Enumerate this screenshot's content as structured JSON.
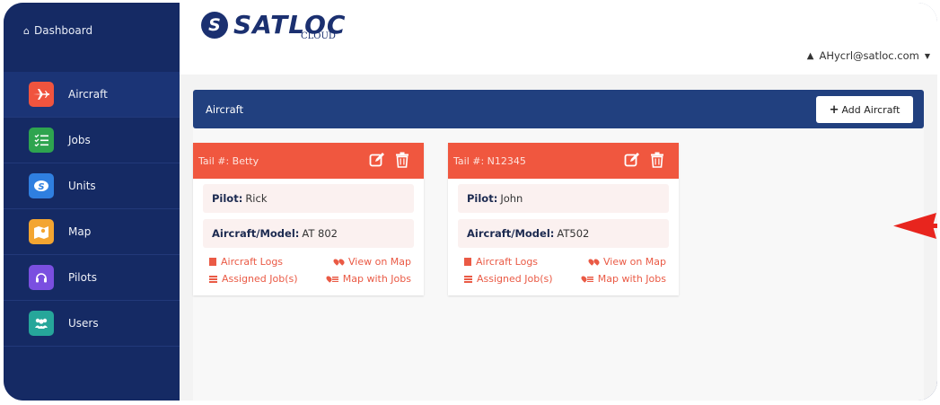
{
  "sidebar": {
    "dashboard_label": "Dashboard",
    "items": [
      {
        "label": "Aircraft",
        "icon": "airplane-icon",
        "color": "#f0543e",
        "active": true
      },
      {
        "label": "Jobs",
        "icon": "checklist-icon",
        "color": "#2ea44f"
      },
      {
        "label": "Units",
        "icon": "satloc-unit-icon",
        "color": "#2f7fe0"
      },
      {
        "label": "Map",
        "icon": "map-icon",
        "color": "#f3a531"
      },
      {
        "label": "Pilots",
        "icon": "headset-icon",
        "color": "#7a4fe0"
      },
      {
        "label": "Users",
        "icon": "users-icon",
        "color": "#26a69a"
      }
    ]
  },
  "header": {
    "logo_text": "SATLOC",
    "logo_subtext": "CLOUD",
    "user_email": "AHycrl@satloc.com"
  },
  "panel": {
    "title": "Aircraft",
    "add_button_label": "Add Aircraft"
  },
  "cards": [
    {
      "title": "Tail #: Betty",
      "pilot_label": "Pilot:",
      "pilot_value": "Rick",
      "model_label": "Aircraft/Model:",
      "model_value": "AT 802",
      "link_logs": "Aircraft Logs",
      "link_view_map": "View on Map",
      "link_jobs": "Assigned Job(s)",
      "link_map_jobs": "Map with Jobs"
    },
    {
      "title": "Tail #: N12345",
      "pilot_label": "Pilot:",
      "pilot_value": "John",
      "model_label": "Aircraft/Model:",
      "model_value": "AT502",
      "link_logs": "Aircraft Logs",
      "link_view_map": "View on Map",
      "link_jobs": "Assigned Job(s)",
      "link_map_jobs": "Map with Jobs"
    }
  ],
  "colors": {
    "sidebar_bg": "#152a64",
    "panel_header": "#21407f",
    "card_header": "#f0573f",
    "annotation_arrow": "#e8251e"
  }
}
